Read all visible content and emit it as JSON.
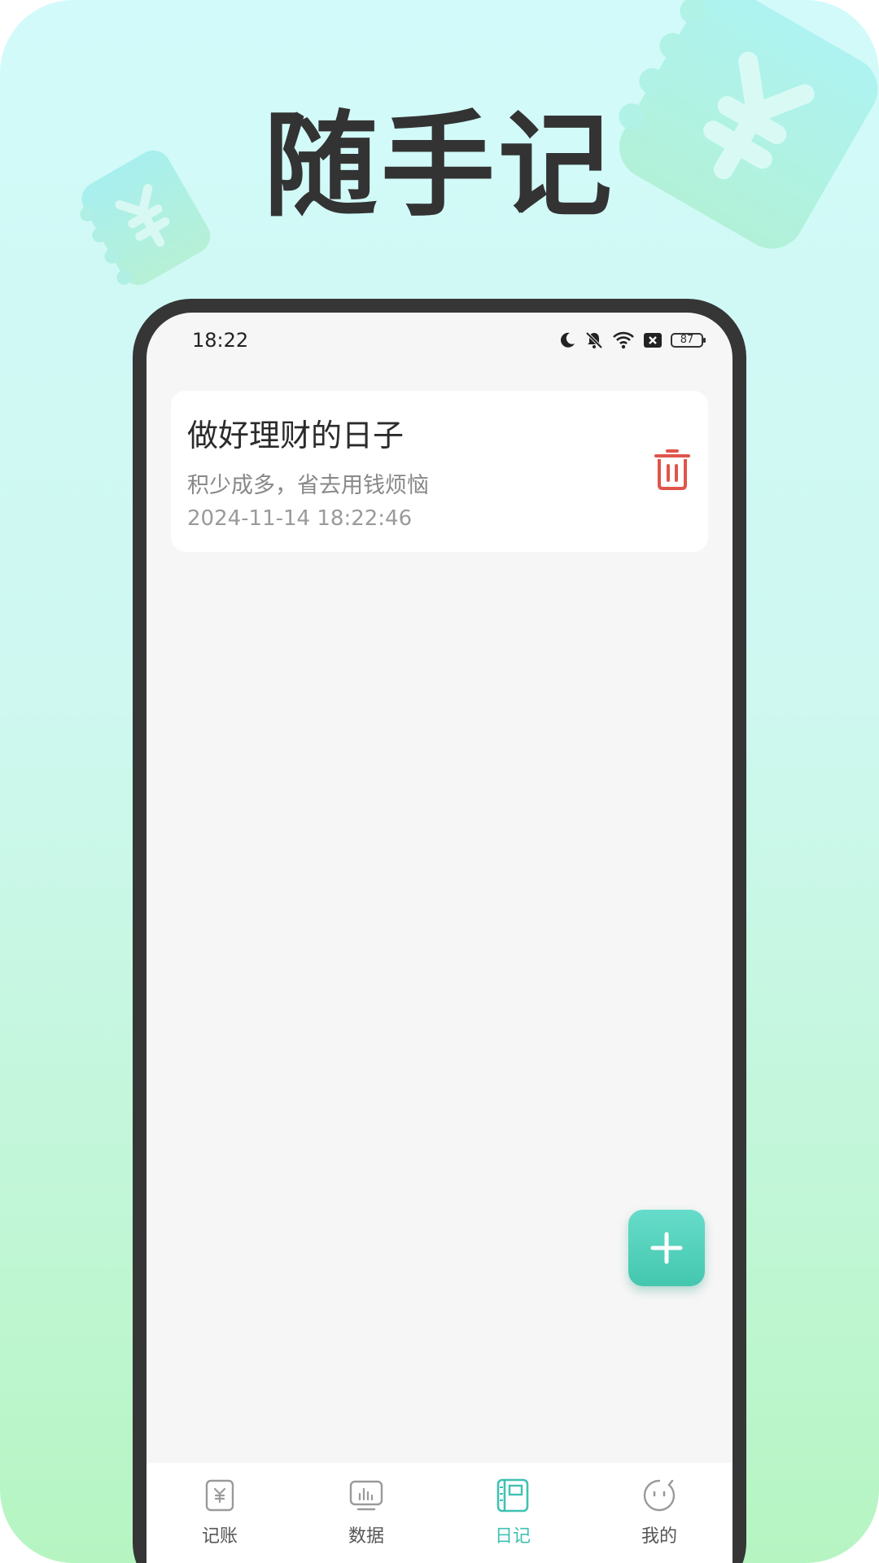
{
  "headline": "随手记",
  "status_bar": {
    "time": "18:22",
    "battery": "87"
  },
  "notes": [
    {
      "title": "做好理财的日子",
      "content": "积少成多，省去用钱烦恼",
      "time": "2024-11-14 18:22:46"
    }
  ],
  "tabs": [
    {
      "label": "记账",
      "icon": "ledger-icon"
    },
    {
      "label": "数据",
      "icon": "chart-icon"
    },
    {
      "label": "日记",
      "icon": "diary-icon"
    },
    {
      "label": "我的",
      "icon": "profile-icon"
    }
  ],
  "active_tab": "日记",
  "colors": {
    "accent": "#3fc1b2",
    "delete": "#e0554a",
    "headline": "#333333"
  }
}
